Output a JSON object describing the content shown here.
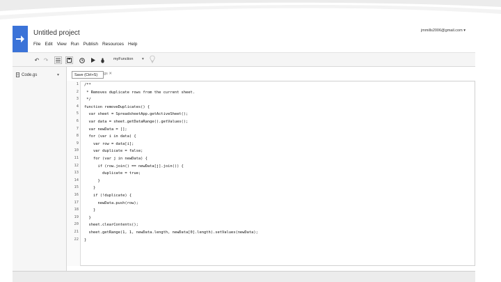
{
  "window": {
    "title": "Untitled project",
    "account": "jmmills2006@gmail.com"
  },
  "menu": [
    "File",
    "Edit",
    "View",
    "Run",
    "Publish",
    "Resources",
    "Help"
  ],
  "toolbar": {
    "function_select": "myFunction",
    "function_caret": "▾"
  },
  "sidebar": {
    "file_name": "Code.gs"
  },
  "editor": {
    "tab_label": "Save (Ctrl+S)",
    "tab_suffix": "gs",
    "lines": [
      "/**",
      " * Removes duplicate rows from the current sheet.",
      " */",
      "function removeDuplicates() {",
      "  var sheet = SpreadsheetApp.getActiveSheet();",
      "  var data = sheet.getDataRange().getValues();",
      "  var newData = [];",
      "  for (var i in data) {",
      "    var row = data[i];",
      "    var duplicate = false;",
      "    for (var j in newData) {",
      "      if (row.join() == newData[j].join()) {",
      "        duplicate = true;",
      "      }",
      "    }",
      "    if (!duplicate) {",
      "      newData.push(row);",
      "    }",
      "  }",
      "  sheet.clearContents();",
      "  sheet.getRange(1, 1, newData.length, newData[0].length).setValues(newData);",
      "}"
    ]
  }
}
